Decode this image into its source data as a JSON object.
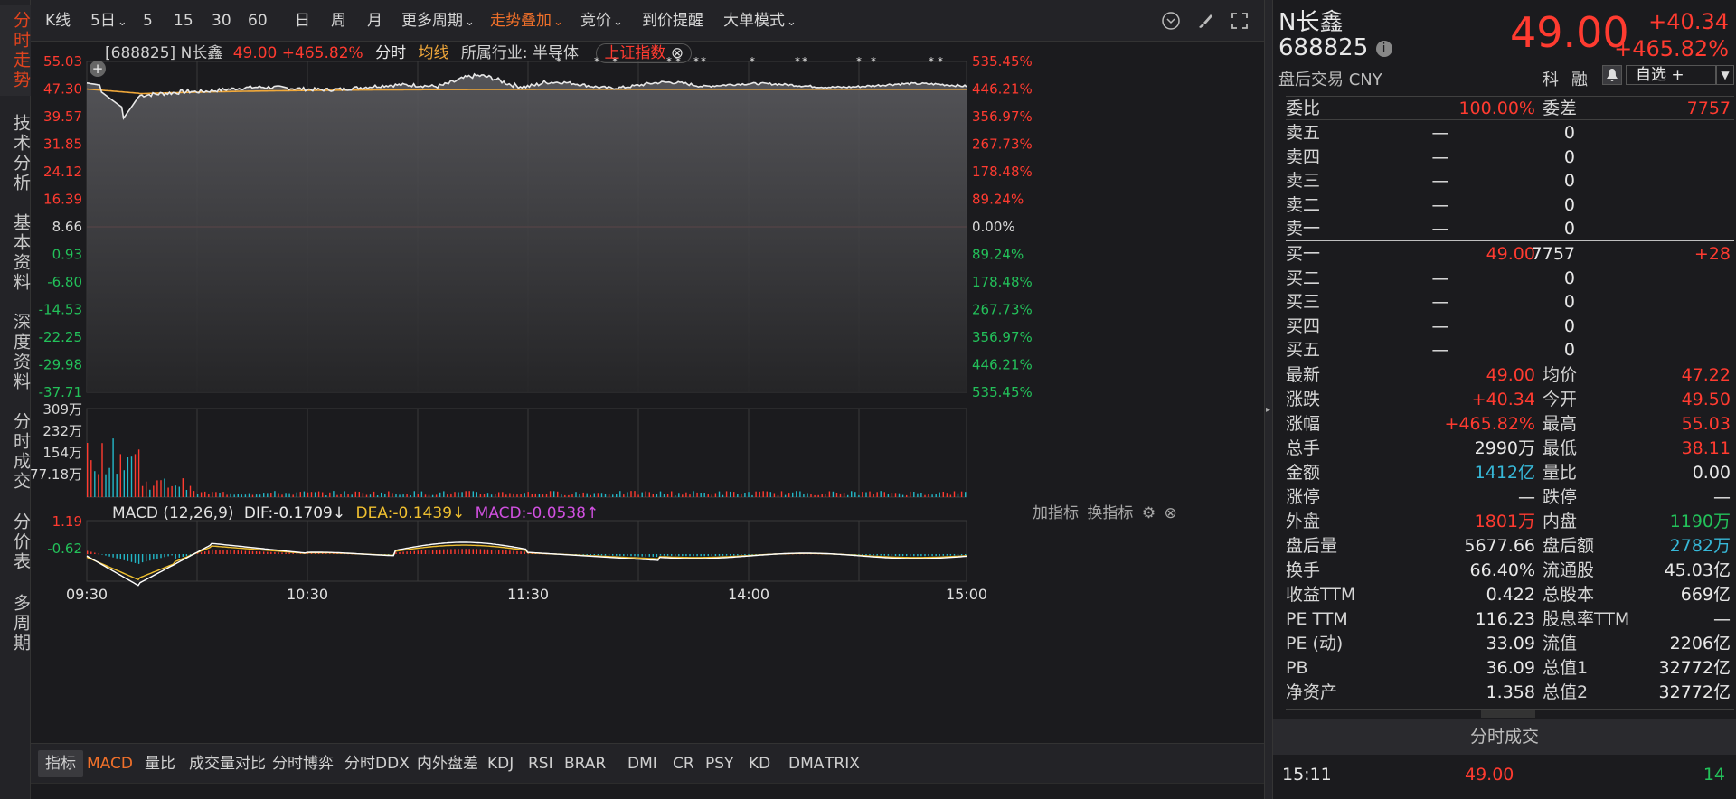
{
  "left_tabs": [
    {
      "label": "分时走势",
      "active": true
    },
    {
      "label": "技术分析",
      "active": false
    },
    {
      "label": "基本资料",
      "active": false
    },
    {
      "label": "深度资料",
      "active": false
    },
    {
      "label": "分时成交",
      "active": false
    },
    {
      "label": "分价表",
      "active": false
    },
    {
      "label": "多周期",
      "active": false
    }
  ],
  "toolbar": {
    "items": [
      "K线",
      "5日",
      "5",
      "15",
      "30",
      "60",
      "日",
      "周",
      "月",
      "更多周期",
      "走势叠加",
      "竞价",
      "到价提醒",
      "大单模式"
    ],
    "dropdown_marker": "⌄"
  },
  "chart": {
    "info": {
      "code": "[688825]",
      "name": "N长鑫",
      "price": "49.00",
      "pct": "+465.82%",
      "mode": "分时",
      "avg_label": "均线",
      "industry": "所属行业: 半导体",
      "overlay": "上证指数"
    },
    "left_axis": [
      "55.03",
      "47.30",
      "39.57",
      "31.85",
      "24.12",
      "16.39",
      "8.66",
      "0.93",
      "-6.80",
      "-14.53",
      "-22.25",
      "-29.98",
      "-37.71"
    ],
    "right_axis": [
      "535.45%",
      "446.21%",
      "356.97%",
      "267.73%",
      "178.48%",
      "89.24%",
      "0.00%",
      "89.24%",
      "178.48%",
      "267.73%",
      "356.97%",
      "446.21%",
      "535.45%"
    ],
    "vol_axis": [
      "309万",
      "232万",
      "154万",
      "77.18万"
    ],
    "macd": {
      "title": "MACD (12,26,9)",
      "dif": "DIF:-0.1709",
      "dea": "DEA:-0.1439",
      "macd": "MACD:-0.0538",
      "add": "加指标",
      "switch": "换指标",
      "axis": [
        "1.19",
        "-0.62"
      ]
    },
    "time_axis": [
      "09:30",
      "10:30",
      "11:30",
      "14:00",
      "15:00"
    ],
    "colors": {
      "price": "#e8e8e8",
      "avg": "#f0a83a",
      "up": "#ff3b30",
      "down": "#23b8c8",
      "zero": "#e05050"
    }
  },
  "chart_data": {
    "type": "line",
    "x": [
      "09:30",
      "10:30",
      "11:30",
      "14:00",
      "15:00"
    ],
    "series": [
      {
        "name": "分时",
        "values": [
          49.0,
          47.5,
          48.3,
          49.6,
          48.9,
          49.0
        ]
      },
      {
        "name": "均线",
        "values": [
          47.3,
          45.5,
          46.9,
          47.2,
          47.2,
          47.22
        ]
      }
    ],
    "ylim": [
      -37.71,
      55.03
    ]
  },
  "indicator_tabs": [
    "指标",
    "MACD",
    "量比",
    "成交量对比",
    "分时博弈",
    "分时DDX",
    "内外盘差",
    "KDJ",
    "RSI",
    "BRAR",
    "DMI",
    "CR",
    "PSY",
    "KD",
    "DMA",
    "TRIX"
  ],
  "quote": {
    "name": "N长鑫",
    "code": "688825",
    "session": "盘后交易 CNY",
    "price": "49.00",
    "change": "+40.34",
    "pct": "+465.82%",
    "tags": [
      "科",
      "融"
    ],
    "watch": "自选 +",
    "weibi_label": "委比",
    "weibi": "100.00%",
    "weicha_label": "委差",
    "weicha": "7757",
    "asks": [
      {
        "label": "卖五",
        "price": "—",
        "vol": "0"
      },
      {
        "label": "卖四",
        "price": "—",
        "vol": "0"
      },
      {
        "label": "卖三",
        "price": "—",
        "vol": "0"
      },
      {
        "label": "卖二",
        "price": "—",
        "vol": "0"
      },
      {
        "label": "卖一",
        "price": "—",
        "vol": "0"
      }
    ],
    "bids": [
      {
        "label": "买一",
        "price": "49.00",
        "vol": "7757",
        "chg": "+28"
      },
      {
        "label": "买二",
        "price": "—",
        "vol": "0",
        "chg": ""
      },
      {
        "label": "买三",
        "price": "—",
        "vol": "0",
        "chg": ""
      },
      {
        "label": "买四",
        "price": "—",
        "vol": "0",
        "chg": ""
      },
      {
        "label": "买五",
        "price": "—",
        "vol": "0",
        "chg": ""
      }
    ],
    "stats": [
      {
        "l": "最新",
        "v": "49.00",
        "c": "red",
        "l2": "均价",
        "v2": "47.22",
        "c2": "red"
      },
      {
        "l": "涨跌",
        "v": "+40.34",
        "c": "red",
        "l2": "今开",
        "v2": "49.50",
        "c2": "red"
      },
      {
        "l": "涨幅",
        "v": "+465.82%",
        "c": "red",
        "l2": "最高",
        "v2": "55.03",
        "c2": "red"
      },
      {
        "l": "总手",
        "v": "2990万",
        "c": "white",
        "l2": "最低",
        "v2": "38.11",
        "c2": "red"
      },
      {
        "l": "金额",
        "v": "1412亿",
        "c": "cyan",
        "l2": "量比",
        "v2": "0.00",
        "c2": "white"
      },
      {
        "l": "涨停",
        "v": "—",
        "c": "white",
        "l2": "跌停",
        "v2": "—",
        "c2": "white"
      },
      {
        "l": "外盘",
        "v": "1801万",
        "c": "red",
        "l2": "内盘",
        "v2": "1190万",
        "c2": "green"
      },
      {
        "l": "盘后量",
        "v": "5677.66",
        "c": "white",
        "l2": "盘后额",
        "v2": "2782万",
        "c2": "cyan"
      },
      {
        "l": "换手",
        "v": "66.40%",
        "c": "white",
        "l2": "流通股",
        "v2": "45.03亿",
        "c2": "white"
      },
      {
        "l": "收益TTM",
        "v": "0.422",
        "c": "white",
        "l2": "总股本",
        "v2": "669亿",
        "c2": "white"
      },
      {
        "l": "PE TTM",
        "v": "116.23",
        "c": "white",
        "l2": "股息率TTM",
        "v2": "—",
        "c2": "white"
      },
      {
        "l": "PE (动)",
        "v": "33.09",
        "c": "white",
        "l2": "流值",
        "v2": "2206亿",
        "c2": "white"
      },
      {
        "l": "PB",
        "v": "36.09",
        "c": "white",
        "l2": "总值1",
        "v2": "32772亿",
        "c2": "white"
      },
      {
        "l": "净资产",
        "v": "1.358",
        "c": "white",
        "l2": "总值2",
        "v2": "32772亿",
        "c2": "white"
      }
    ],
    "trades_title": "分时成交",
    "trade": {
      "time": "15:11",
      "price": "49.00",
      "vol": "14"
    }
  }
}
